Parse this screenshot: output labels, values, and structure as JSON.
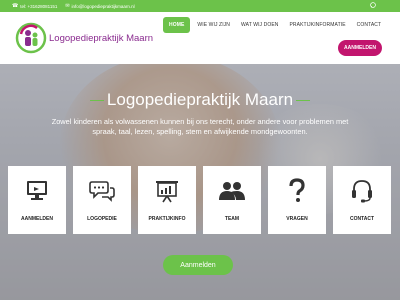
{
  "topbar": {
    "phone": "+31628081151",
    "phone_label": "tel:",
    "email": "info@logopediepraktijkmaarn.nl",
    "social_icon": "whatsapp-icon"
  },
  "header": {
    "logo_text": "Logopediepraktijk Maarn",
    "nav": [
      {
        "label": "HOME"
      },
      {
        "label": "WIE WIJ ZIJN"
      },
      {
        "label": "WAT WIJ DOEN"
      },
      {
        "label": "PRAKTIJKINFORMATIE"
      },
      {
        "label": "CONTACT"
      }
    ],
    "cta_label": "AANMELDEN"
  },
  "hero": {
    "title": "Logopediepraktijk Maarn",
    "subtitle": "Zowel kinderen als volwassenen kunnen bij ons terecht, onder andere voor problemen met spraak, taal, lezen, spelling, stem en afwijkende mondgewoonten.",
    "cards": [
      {
        "label": "AANMELDEN",
        "icon": "monitor-icon"
      },
      {
        "label": "LOGOPEDIE",
        "icon": "speech-bubbles-icon"
      },
      {
        "label": "PRAKTIJKINFO",
        "icon": "presentation-board-icon"
      },
      {
        "label": "TEAM",
        "icon": "people-icon"
      },
      {
        "label": "VRAGEN",
        "icon": "question-mark-icon"
      },
      {
        "label": "CONTACT",
        "icon": "headset-icon"
      }
    ],
    "button_label": "Aanmelden"
  },
  "colors": {
    "green": "#6cc24a",
    "purple": "#8a2b8f",
    "magenta": "#c2156e",
    "icon_dark": "#333333"
  }
}
